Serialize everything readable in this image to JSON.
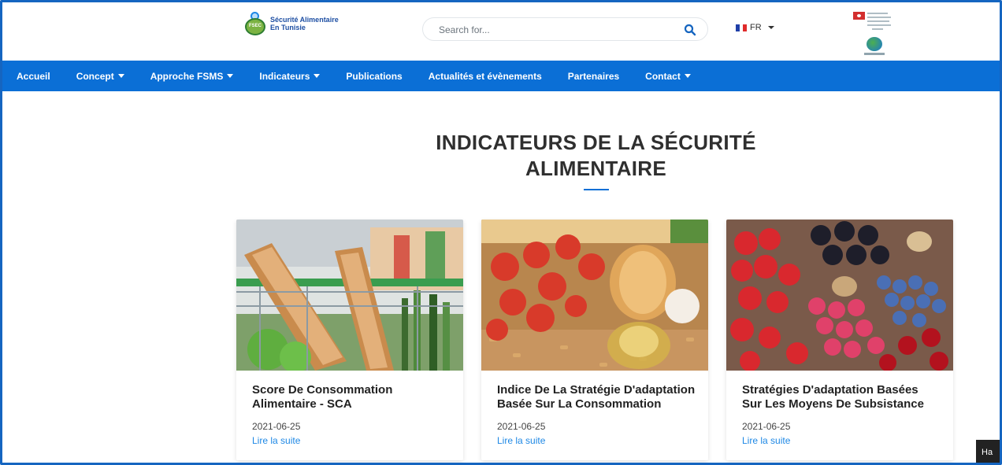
{
  "header": {
    "logo_line1": "Sécurité Alimentaire",
    "logo_line2": "En Tunisie",
    "logo_badge": "FSEC",
    "search_placeholder": "Search for...",
    "lang": "FR"
  },
  "nav": {
    "items": [
      {
        "label": "Accueil",
        "dropdown": false
      },
      {
        "label": "Concept",
        "dropdown": true
      },
      {
        "label": "Approche FSMS",
        "dropdown": true
      },
      {
        "label": "Indicateurs",
        "dropdown": true
      },
      {
        "label": "Publications",
        "dropdown": false
      },
      {
        "label": "Actualités et évènements",
        "dropdown": false
      },
      {
        "label": "Partenaires",
        "dropdown": false
      },
      {
        "label": "Contact",
        "dropdown": true
      }
    ]
  },
  "main": {
    "title_line1": "INDICATEURS DE LA SÉCURITÉ",
    "title_line2": "ALIMENTAIRE",
    "cards": [
      {
        "title": "Score De Consommation Alimentaire - SCA",
        "date": "2021-06-25",
        "link": "Lire la suite"
      },
      {
        "title": "Indice De La Stratégie D'adaptation Basée Sur La Consommation",
        "date": "2021-06-25",
        "link": "Lire la suite"
      },
      {
        "title": "Stratégies D'adaptation Basées Sur Les Moyens De Subsistance",
        "date": "2021-06-25",
        "link": "Lire la suite"
      }
    ]
  },
  "widget": {
    "label": "Ha"
  },
  "colors": {
    "primary": "#0b6fd6",
    "link": "#1e88e5",
    "frame": "#1565c0"
  }
}
